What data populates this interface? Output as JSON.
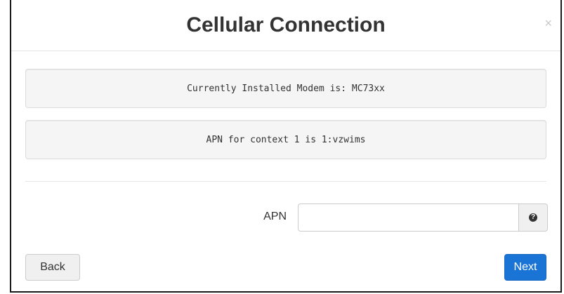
{
  "dialog": {
    "title": "Cellular Connection",
    "close_glyph": "×"
  },
  "info": {
    "modem": "Currently Installed Modem is: MC73xx",
    "apn_context": "APN for context 1 is 1:vzwims"
  },
  "form": {
    "apn_label": "APN",
    "apn_value": "",
    "help_icon": "question-circle-icon",
    "help_glyph": "?"
  },
  "buttons": {
    "back": "Back",
    "next": "Next"
  },
  "colors": {
    "primary": "#1a74d6"
  }
}
